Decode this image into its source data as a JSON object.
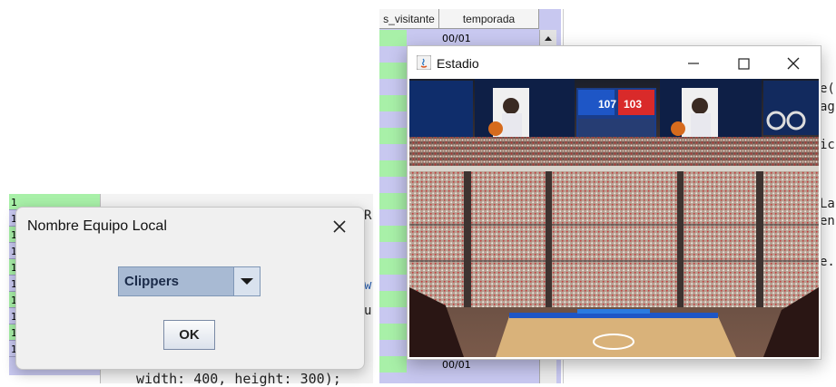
{
  "background": {
    "left_table_rows": [
      "1",
      "1",
      "1",
      "1",
      "1",
      "1",
      "1",
      "1",
      "1",
      "1"
    ],
    "table_header_col1": "s_visitante",
    "table_header_col2": "temporada",
    "first_season": "00/01",
    "bottom_cell": "00/01",
    "code_left_1": "R",
    "code_left_2": "w",
    "code_left_3": "u",
    "code_bottom": "width: 400, height: 300);",
    "code_right_1": "e(",
    "code_right_2": "ag",
    "code_right_3": "ic",
    "code_right_4": "La",
    "code_right_5": "en",
    "code_right_6": "e."
  },
  "dialog": {
    "title": "Nombre Equipo Local",
    "combo_value": "Clippers",
    "ok_label": "OK"
  },
  "stadium_window": {
    "title": "Estadio",
    "scoreboard_home": "107",
    "scoreboard_away": "103"
  }
}
